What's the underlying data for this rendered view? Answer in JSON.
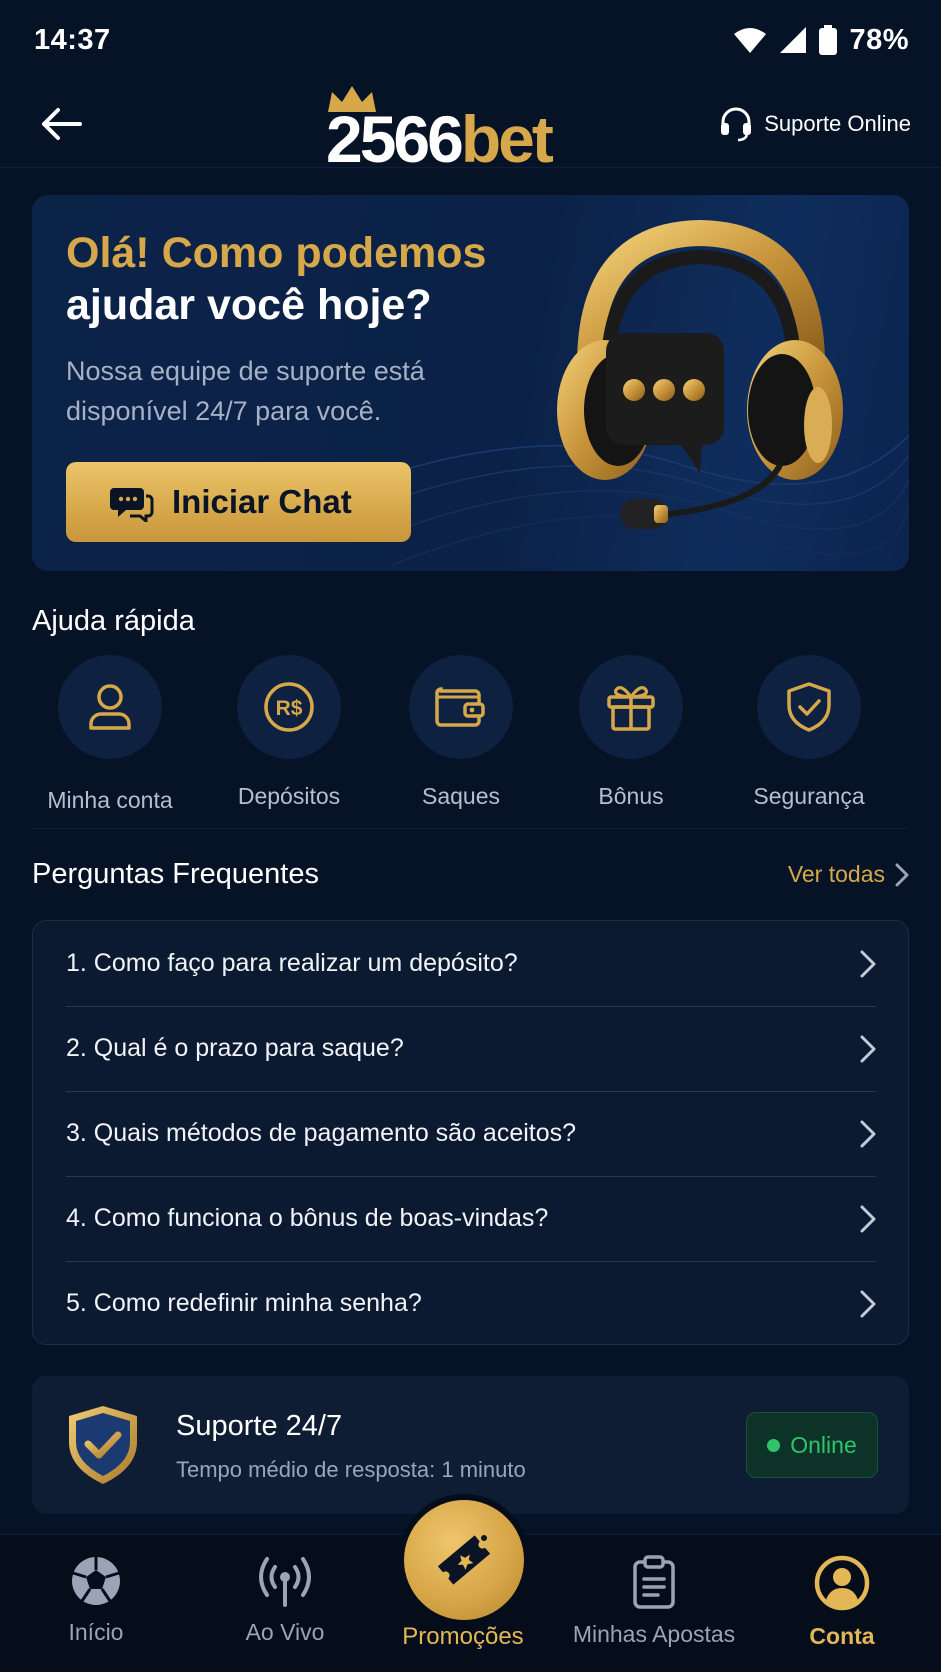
{
  "status_bar": {
    "time": "14:37",
    "battery": "78%"
  },
  "header": {
    "logo_number": "2566",
    "logo_suffix": "bet",
    "support_label": "Suporte Online"
  },
  "hero": {
    "title_line1": "Olá! Como podemos",
    "title_line2": "ajudar você hoje?",
    "subtitle": "Nossa equipe de suporte está disponível 24/7 para você.",
    "button_label": "Iniciar Chat"
  },
  "quick_help": {
    "title": "Ajuda rápida",
    "items": [
      {
        "label": "Minha conta",
        "icon": "user-icon"
      },
      {
        "label": "Depósitos",
        "icon": "currency-icon"
      },
      {
        "label": "Saques",
        "icon": "wallet-icon"
      },
      {
        "label": "Bônus",
        "icon": "gift-icon"
      },
      {
        "label": "Segurança",
        "icon": "shield-check-icon"
      }
    ]
  },
  "faq": {
    "title": "Perguntas Frequentes",
    "see_all": "Ver todas",
    "items": [
      "1. Como faço para realizar um depósito?",
      "2. Qual é o prazo para saque?",
      "3. Quais métodos de pagamento são aceitos?",
      "4. Como funciona o bônus de boas-vindas?",
      "5. Como redefinir minha senha?"
    ]
  },
  "support_card": {
    "title": "Suporte 24/7",
    "subtitle": "Tempo médio de resposta: 1 minuto",
    "status": "Online"
  },
  "bottom_nav": {
    "items": [
      {
        "label": "Início",
        "icon": "soccer-ball-icon"
      },
      {
        "label": "Ao Vivo",
        "icon": "broadcast-icon"
      },
      {
        "label": "Promoções",
        "icon": "ticket-icon"
      },
      {
        "label": "Minhas Apostas",
        "icon": "clipboard-icon"
      },
      {
        "label": "Conta",
        "icon": "account-icon"
      }
    ],
    "active": "Conta"
  },
  "colors": {
    "background": "#061226",
    "accent_gold": "#d6a84a",
    "online_green": "#2fc46b"
  }
}
